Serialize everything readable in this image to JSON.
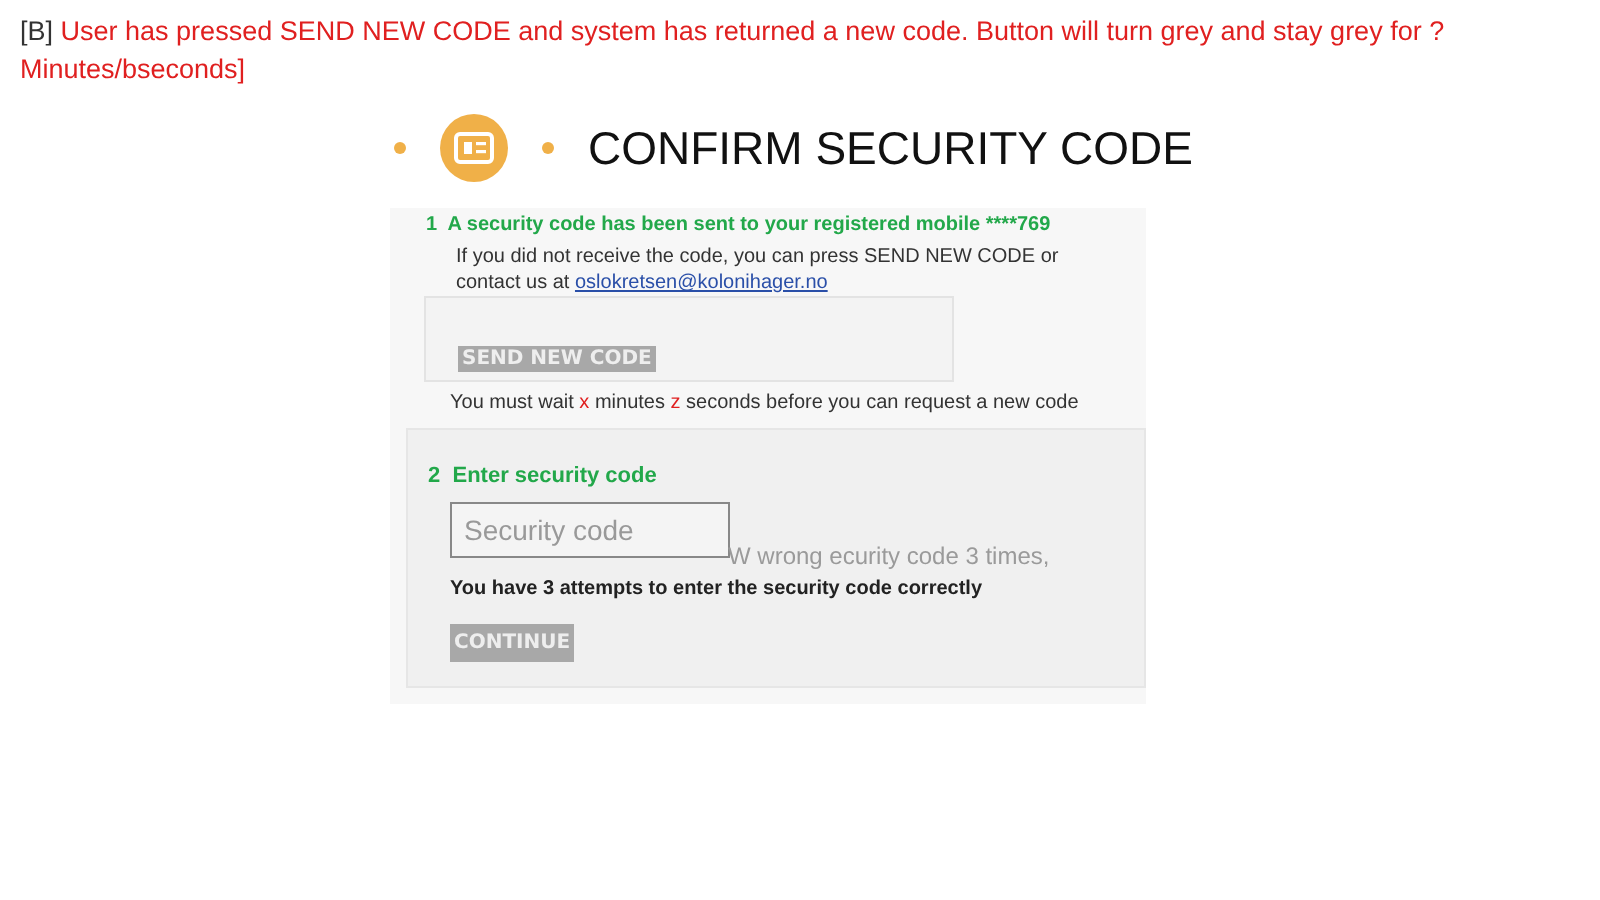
{
  "note": {
    "tag": "[B]",
    "text": "User has pressed SEND NEW CODE and system has returned a new code. Button will turn grey and stay grey for ? Minutes/bseconds]"
  },
  "header": {
    "title": "CONFIRM SECURITY CODE"
  },
  "step1": {
    "number": "1",
    "title": "A security code has been sent to your registered mobile ****769",
    "info": "If you did not receive the code, you can press SEND NEW CODE or contact us at",
    "email": "oslokretsen@kolonihager.no",
    "button": {
      "label": "SEND NEW CODE",
      "disabled": true
    },
    "wait": [
      {
        "text": "You must wait ",
        "highlight": false
      },
      {
        "text": "x",
        "highlight": true
      },
      {
        "text": " minutes ",
        "highlight": false
      },
      {
        "text": "z",
        "highlight": true
      },
      {
        "text": " seconds before you can request a new code",
        "highlight": false
      }
    ]
  },
  "step2": {
    "number": "2",
    "title": "Enter security code",
    "field": {
      "placeholder": "Security code"
    },
    "overlay": "W wrong ecurity code 3 times,",
    "attempts": "You have 3 attempts to enter the security code correctly",
    "button": {
      "label": "CONTINUE",
      "disabled": true
    }
  }
}
